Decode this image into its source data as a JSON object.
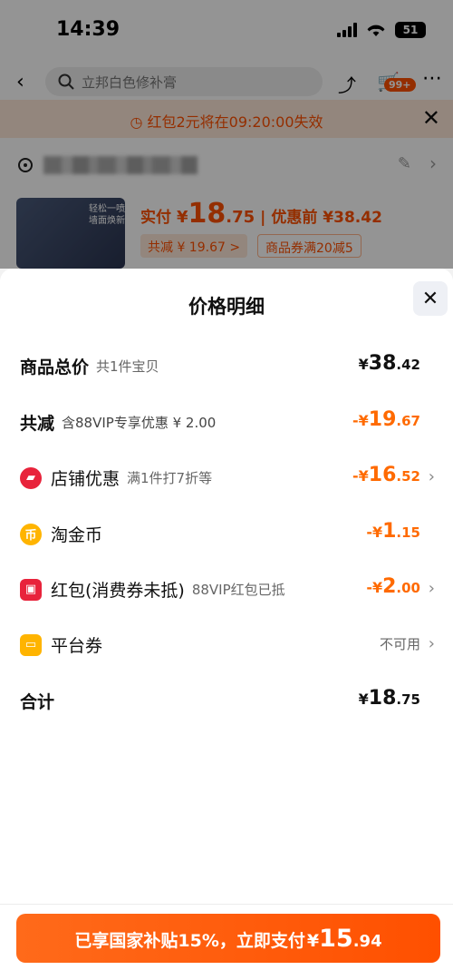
{
  "status": {
    "time": "14:39",
    "battery": "51"
  },
  "background": {
    "search_placeholder": "立邦白色修补膏",
    "cart_badge": "99+",
    "notice": "红包2元将在09:20:00失效",
    "thumb_caption_1": "轻松一喷",
    "thumb_caption_2": "墙面焕新",
    "price_label": "实付",
    "price_yen": "¥",
    "price_int": "18",
    "price_dec": ".75",
    "price_sep": "|",
    "orig_price": "优惠前 ¥38.42",
    "chip_discount": "共减 ¥ 19.67 >",
    "chip_coupon": "商品券满20减5"
  },
  "sheet": {
    "title": "价格明细",
    "close_label": "✕",
    "rows": [
      {
        "label": "商品总价",
        "sub": "共1件宝贝",
        "yen": "¥",
        "int": "38",
        "dec": ".42"
      },
      {
        "label": "共减",
        "sub": "含88VIP专享优惠 ¥ 2.00",
        "yen": "-¥",
        "int": "19",
        "dec": ".67"
      },
      {
        "label": "店铺优惠",
        "sub": "满1件打7折等",
        "yen": "-¥",
        "int": "16",
        "dec": ".52"
      },
      {
        "label": "淘金币",
        "sub": "",
        "yen": "-¥",
        "int": "1",
        "dec": ".15"
      },
      {
        "label": "红包(消费券未抵)",
        "sub": "88VIP红包已抵",
        "yen": "-¥",
        "int": "2",
        "dec": ".00"
      },
      {
        "label": "平台券",
        "sub": "",
        "value_text": "不可用"
      },
      {
        "label": "合计",
        "sub": "",
        "yen": "¥",
        "int": "18",
        "dec": ".75"
      }
    ]
  },
  "pay": {
    "text": "已享国家补贴15%，立即支付",
    "yen": "¥",
    "int": "15",
    "dec": ".94"
  },
  "colors": {
    "accent": "#ff5000",
    "discount": "#ff6a00"
  }
}
